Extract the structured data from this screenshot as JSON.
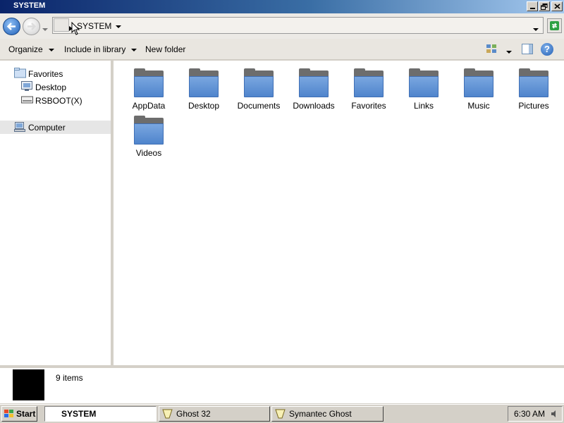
{
  "window": {
    "title": "SYSTEM"
  },
  "address": {
    "path": "SYSTEM"
  },
  "toolbar": {
    "organize": "Organize",
    "include": "Include in library",
    "new_folder": "New folder"
  },
  "nav": {
    "favorites": "Favorites",
    "desktop": "Desktop",
    "rsboot": "RSBOOT(X)",
    "computer": "Computer"
  },
  "folders": [
    "AppData",
    "Desktop",
    "Documents",
    "Downloads",
    "Favorites",
    "Links",
    "Music",
    "Pictures",
    "Videos"
  ],
  "details": {
    "count": "9 items"
  },
  "taskbar": {
    "start": "Start",
    "tasks": [
      "SYSTEM",
      "Ghost 32",
      "Symantec Ghost"
    ],
    "clock": "6:30 AM"
  },
  "colors": {
    "titlebar_start": "#0a246a",
    "titlebar_end": "#a6caf0",
    "folder_blue": "#4f84cc",
    "selection_bg": "#e6e6e6"
  }
}
